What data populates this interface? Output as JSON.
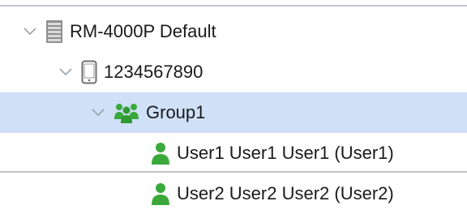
{
  "tree": {
    "items": [
      {
        "label": "RM-4000P Default",
        "icon": "server-icon",
        "expanded": true,
        "selected": false
      },
      {
        "label": "1234567890",
        "icon": "mobile-device-icon",
        "expanded": true,
        "selected": false
      },
      {
        "label": "Group1",
        "icon": "group-icon",
        "expanded": true,
        "selected": true
      },
      {
        "label": "User1 User1 User1 (User1)",
        "icon": "user-icon",
        "selected": false
      },
      {
        "label": "User2 User2 User2 (User2)",
        "icon": "user-icon",
        "selected": false
      }
    ]
  },
  "colors": {
    "selection_bg": "#cfe0f7",
    "user_green": "#3aa93a",
    "divider": "#bfc6cf",
    "chevron": "#9aa4ad"
  }
}
